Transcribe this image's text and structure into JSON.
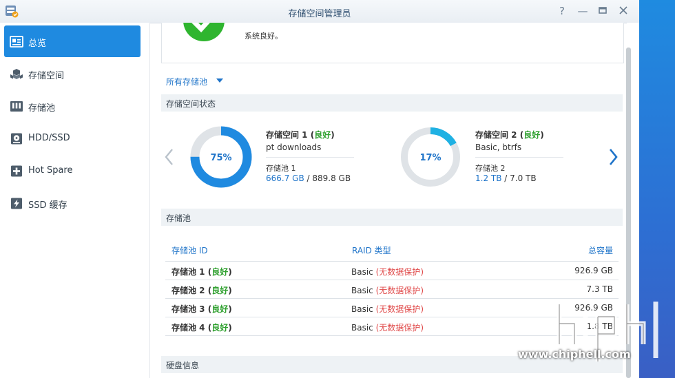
{
  "window": {
    "title": "存储空间管理员"
  },
  "titlebar": {
    "help": "?",
    "minimize": "—",
    "maximize": "▭",
    "close": "✕"
  },
  "sidebar": {
    "items": [
      {
        "label": "总览",
        "icon": "overview-icon",
        "active": true
      },
      {
        "label": "存储空间",
        "icon": "cubes-icon"
      },
      {
        "label": "存储池",
        "icon": "pool-icon"
      },
      {
        "label": "HDD/SSD",
        "icon": "disk-icon"
      },
      {
        "label": "Hot Spare",
        "icon": "plus-box-icon"
      },
      {
        "label": "SSD 缓存",
        "icon": "flash-icon"
      }
    ]
  },
  "health": {
    "message": "系统良好。",
    "status_color": "#2fb52f"
  },
  "filter": {
    "label": "所有存储池"
  },
  "sections": {
    "volume_status": "存储空间状态",
    "pools": "存储池",
    "disks": "硬盘信息"
  },
  "volumes": [
    {
      "name": "存储空间 1",
      "status": "良好",
      "percent_label": "75%",
      "percent": 75,
      "desc": "pt downloads",
      "pool": "存储池 1",
      "used": "666.7 GB",
      "total": "889.8 GB"
    },
    {
      "name": "存储空间 2",
      "status": "良好",
      "percent_label": "17%",
      "percent": 17,
      "desc": "Basic, btrfs",
      "pool": "存储池 2",
      "used": "1.2 TB",
      "total": "7.0 TB"
    }
  ],
  "pool_table": {
    "headers": {
      "id": "存储池 ID",
      "raid": "RAID 类型",
      "capacity": "总容量"
    },
    "rows": [
      {
        "id": "存储池 1",
        "status": "良好",
        "raid": "Basic",
        "protect": "无数据保护",
        "capacity": "926.9 GB"
      },
      {
        "id": "存储池 2",
        "status": "良好",
        "raid": "Basic",
        "protect": "无数据保护",
        "capacity": "7.3 TB"
      },
      {
        "id": "存储池 3",
        "status": "良好",
        "raid": "Basic",
        "protect": "无数据保护",
        "capacity": "926.9 GB"
      },
      {
        "id": "存储池 4",
        "status": "良好",
        "raid": "Basic",
        "protect": "无数据保护",
        "capacity": "1.8 TB"
      }
    ]
  },
  "colors": {
    "accent": "#1f8ae0",
    "good": "#2ea02e",
    "warn": "#e04a4a"
  },
  "watermark": {
    "text": "www.chiphell.com"
  }
}
